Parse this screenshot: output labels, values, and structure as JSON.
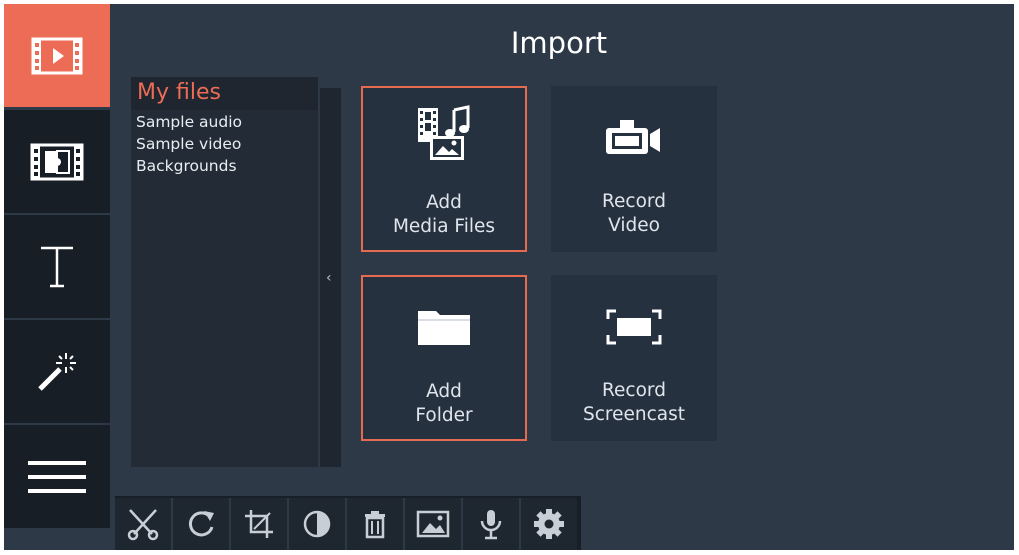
{
  "window": {
    "title": "Import"
  },
  "rail": {
    "items": [
      {
        "name": "import",
        "icon": "film-play-icon",
        "active": true
      },
      {
        "name": "transitions",
        "icon": "film-puzzle-icon"
      },
      {
        "name": "titles",
        "icon": "text-t-icon"
      },
      {
        "name": "filters",
        "icon": "magic-wand-icon"
      },
      {
        "name": "more",
        "icon": "hamburger-menu-icon"
      }
    ]
  },
  "files": {
    "header": "My files",
    "items": [
      "Sample audio",
      "Sample video",
      "Backgrounds"
    ],
    "collapse_glyph": "‹"
  },
  "tiles": {
    "add_media": {
      "line1": "Add",
      "line2": "Media Files",
      "icon": "media-files-icon"
    },
    "record_video": {
      "line1": "Record",
      "line2": "Video",
      "icon": "video-camera-icon"
    },
    "add_folder": {
      "line1": "Add",
      "line2": "Folder",
      "icon": "folder-icon"
    },
    "record_screencast": {
      "line1": "Record",
      "line2": "Screencast",
      "icon": "screen-capture-icon"
    }
  },
  "toolbar": {
    "tools": [
      "cut",
      "rotate",
      "crop",
      "color-adjust",
      "delete",
      "image",
      "microphone",
      "settings"
    ]
  },
  "colors": {
    "accent": "#ec6c55",
    "background": "#2e3948",
    "rail": "#171e26",
    "tile": "#263140",
    "panel": "#232b36"
  }
}
